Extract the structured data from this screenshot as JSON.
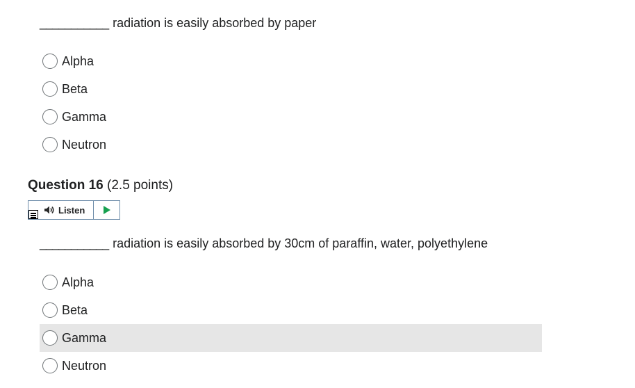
{
  "question15": {
    "blank": "___________",
    "prompt": "radiation is easily absorbed by paper",
    "options": [
      "Alpha",
      "Beta",
      "Gamma",
      "Neutron"
    ]
  },
  "question16": {
    "title": "Question 16",
    "points": "(2.5 points)",
    "listen_label": "Listen",
    "blank": "___________",
    "prompt": "radiation is easily absorbed by 30cm of paraffin, water, polyethylene",
    "options": [
      "Alpha",
      "Beta",
      "Gamma",
      "Neutron"
    ]
  },
  "colors": {
    "hover_row": "#e6e6e6",
    "play": "#18a150",
    "listen_border": "#6d8ca9"
  },
  "icons": [
    "menu-icon",
    "speaker-icon",
    "play-icon",
    "radio-button"
  ]
}
